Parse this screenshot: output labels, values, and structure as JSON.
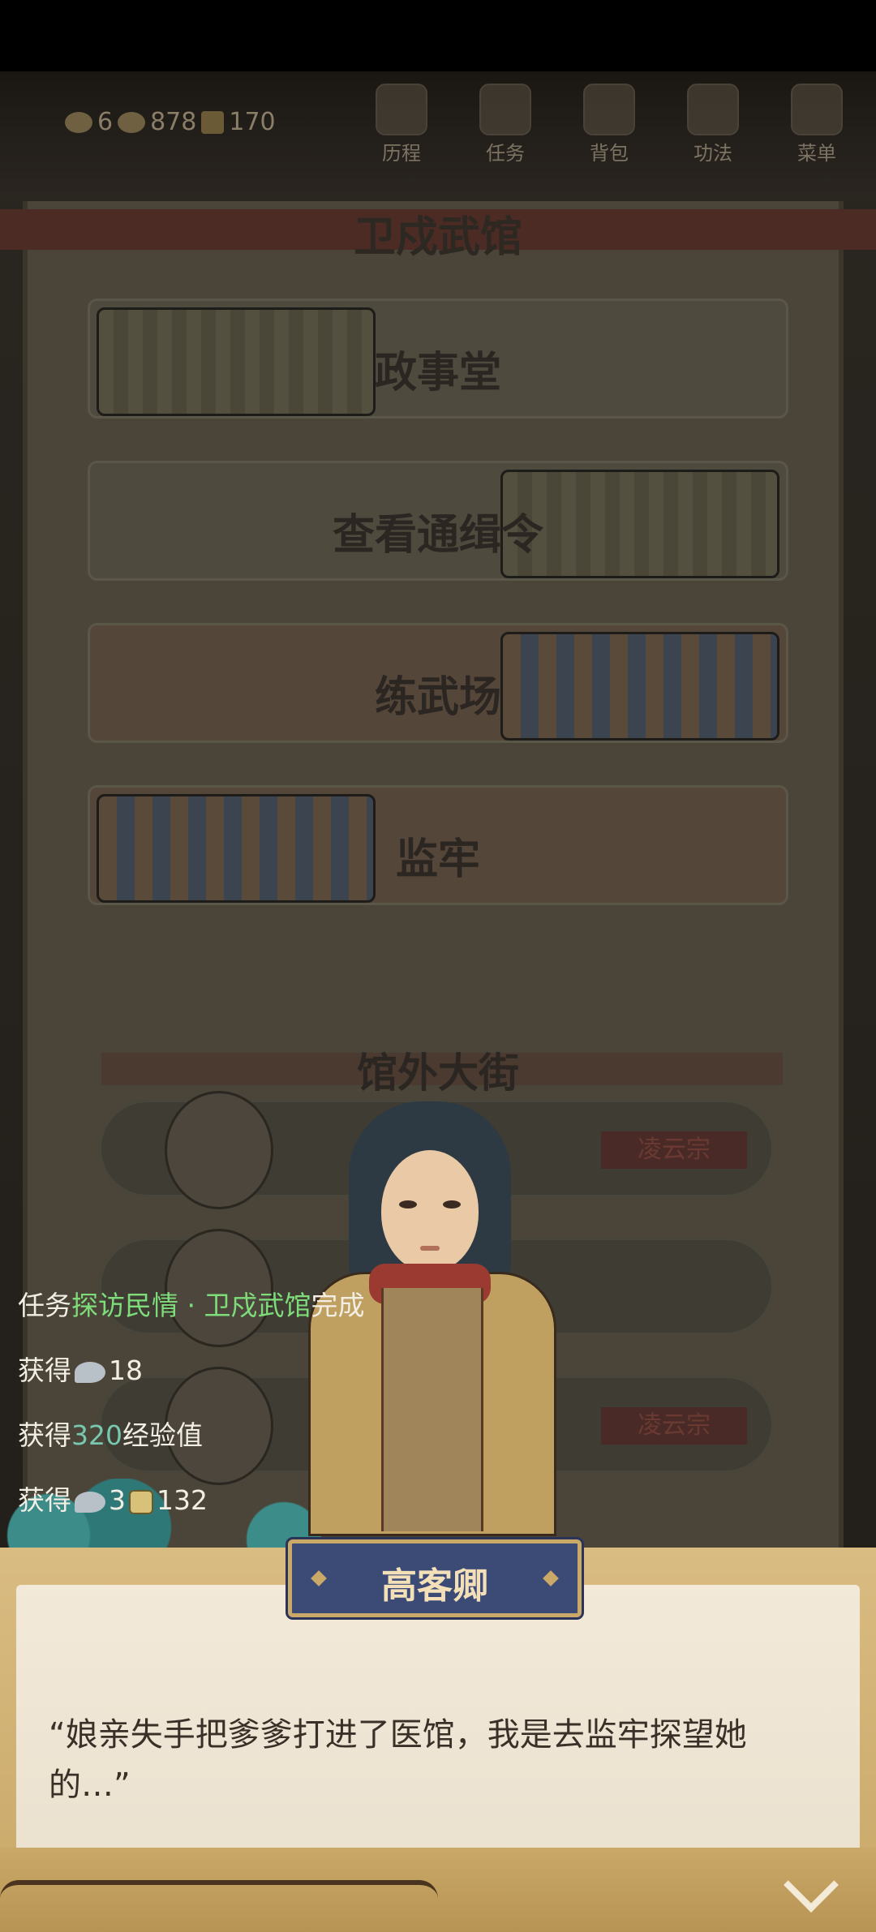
{
  "topbar": {
    "currency": {
      "jade": "6",
      "silver": "878",
      "coin": "170"
    },
    "nav": [
      {
        "label": "历程",
        "icon": "journey-icon"
      },
      {
        "label": "任务",
        "icon": "quest-icon"
      },
      {
        "label": "背包",
        "icon": "bag-icon"
      },
      {
        "label": "功法",
        "icon": "scroll-icon"
      },
      {
        "label": "菜单",
        "icon": "fan-menu-icon"
      }
    ]
  },
  "location": {
    "title": "卫戍武馆",
    "places": [
      "政事堂",
      "查看通缉令",
      "练武场",
      "监牢"
    ],
    "street_title": "馆外大街",
    "npcs": [
      {
        "tag": "凌云宗"
      },
      {
        "tag": ""
      },
      {
        "tag": "凌云宗"
      }
    ]
  },
  "log": {
    "quest_prefix": "任务",
    "quest_name": "探访民情 · 卫戍武馆",
    "quest_suffix": "完成",
    "gain_label": "获得",
    "silver_amount": "18",
    "exp_amount": "320",
    "exp_label": "经验值",
    "reward_silver": "3",
    "reward_coin": "132"
  },
  "dialog": {
    "speaker": "高客卿",
    "text": "“娘亲失手把爹爹打进了医馆，我是去监牢探望她的…”"
  }
}
